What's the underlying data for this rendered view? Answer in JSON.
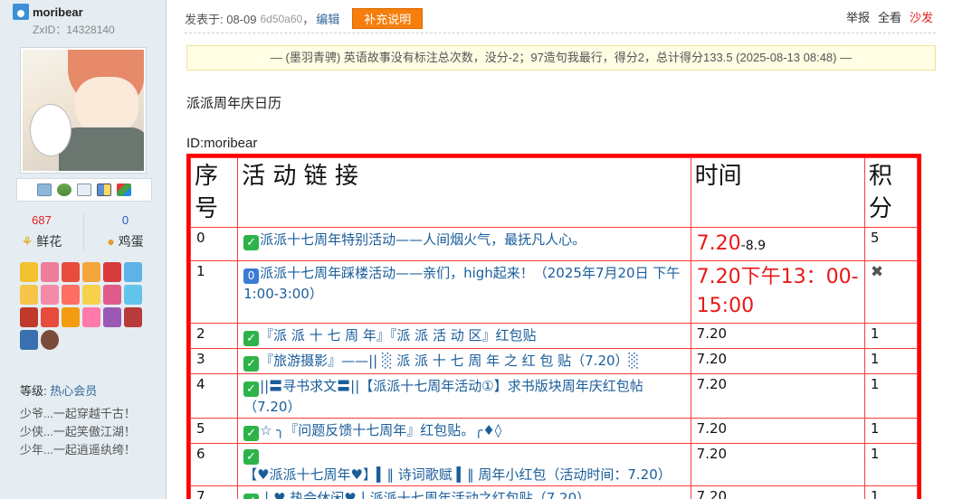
{
  "user": {
    "name": "moribear",
    "zxid": "ZxID：14328140",
    "stats": [
      {
        "value": "687",
        "label": "鲜花",
        "color": "#e02020"
      },
      {
        "value": "0",
        "label": "鸡蛋",
        "color": "#2255bb"
      }
    ],
    "level_label": "等级:",
    "level_value": "热心会员",
    "motto": [
      "少爷...一起穿越千古！",
      "少侠...一起笑傲江湖！",
      "少年...一起逍遥纨绔！"
    ],
    "tool_icons": [
      "message-icon",
      "add-friend-icon",
      "profile-icon",
      "album-icon",
      "blocks-icon"
    ]
  },
  "post": {
    "posted_prefix": "发表于: 08-09",
    "hash": "6d50a60",
    "sep": "，",
    "edit_label": "编辑",
    "supplement_label": "补充说明",
    "actions": {
      "report": "举报",
      "view_all": "全看",
      "sofa": "沙发"
    },
    "notice": "— (墨羽青骋) 英语故事没有标注总次数，没分-2；97造句我最行，得分2，总计得分133.5 (2025-08-13 08:48) —",
    "para1": "派派周年庆日历",
    "para2": "ID:moribear"
  },
  "table": {
    "headers": {
      "idx": "序号",
      "link": "活 动 链 接",
      "time": "时间",
      "score": "积分"
    },
    "rows": [
      {
        "idx": "0",
        "badge": "check",
        "link": "派派十七周年特别活动——人间烟火气，最抚凡人心。",
        "time_big": "7.20",
        "time_sub": "-8.9",
        "score": "5"
      },
      {
        "idx": "1",
        "badge": "zero",
        "link": "派派十七周年踩楼活动——亲们，high起来！（2025年7月20日 下午1:00-3:00）",
        "time_big": "7.20下午13：00-15:00",
        "time_sub": "",
        "score": "✖"
      },
      {
        "idx": "2",
        "badge": "check",
        "link": "『派 派 十 七 周 年』『派 派 活 动 区』红包贴",
        "time": "7.20",
        "score": "1"
      },
      {
        "idx": "3",
        "badge": "check",
        "link": "『旅游摄影』——|| ░ 派 派 十 七 周 年 之 红 包 贴（7.20）░",
        "time": "7.20",
        "score": "1"
      },
      {
        "idx": "4",
        "badge": "check",
        "link": "||〓寻书求文〓||【派派十七周年活动①】求书版块周年庆红包帖（7.20）",
        "time": "7.20",
        "score": "1"
      },
      {
        "idx": "5",
        "badge": "check",
        "link": "☆ ╮『问题反馈十七周年』红包贴。╭♦◊",
        "time": "7.20",
        "score": "1"
      },
      {
        "idx": "6",
        "badge": "check",
        "link": "【♥派派十七周年♥】▍‖ 诗词歌赋 ▍‖ 周年小红包（活动时间：7.20）",
        "time": "7.20",
        "score": "1"
      },
      {
        "idx": "7",
        "badge": "check",
        "link": "丨♥ 热会休闲♥丨派派十七周年活动之红包贴（7.20）",
        "time": "7.20",
        "score": "1"
      }
    ]
  }
}
